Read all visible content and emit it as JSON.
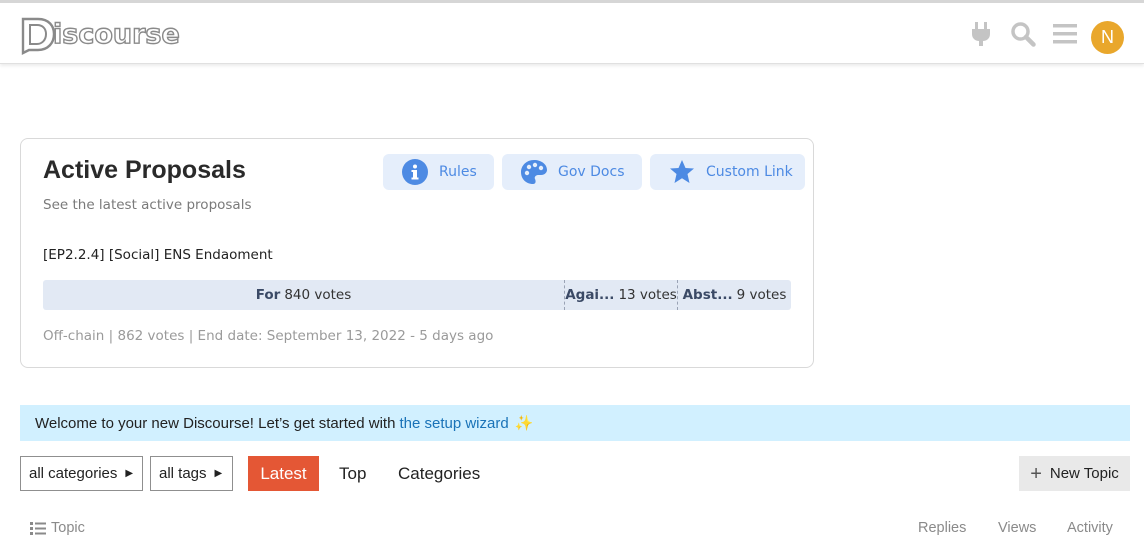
{
  "header": {
    "logo_text": "iscourse",
    "icons": [
      "plug-icon",
      "search-icon",
      "menu-icon"
    ],
    "avatar_letter": "N",
    "avatar_color": "#e9a72c"
  },
  "proposals": {
    "title": "Active Proposals",
    "subtitle": "See the latest active proposals",
    "links": [
      {
        "label": "Rules",
        "icon": "info-icon"
      },
      {
        "label": "Gov Docs",
        "icon": "palette-icon"
      },
      {
        "label": "Custom Link",
        "icon": "star-icon"
      }
    ],
    "proposal_title": "[EP2.2.4] [Social] ENS Endaoment",
    "votes": [
      {
        "choice": "For",
        "count": "840 votes",
        "value": 840
      },
      {
        "choice": "Agai...",
        "count": "13 votes",
        "value": 13
      },
      {
        "choice": "Abst...",
        "count": "9 votes",
        "value": 9
      }
    ],
    "meta": "Off-chain | 862 votes | End date: September 13, 2022 - 5 days ago"
  },
  "banner": {
    "text": "Welcome to your new Discourse! Let’s get started with",
    "link": "the setup wizard",
    "emoji": "✨"
  },
  "nav": {
    "categories_dropdown": "all categories",
    "tags_dropdown": "all tags",
    "tabs": [
      "Latest",
      "Top",
      "Categories"
    ],
    "new_topic": "New Topic"
  },
  "topic_list": {
    "columns": [
      "Topic",
      "Replies",
      "Views",
      "Activity"
    ]
  },
  "colors": {
    "accent": "#e45735",
    "link": "#4d8ae3",
    "banner_bg": "#d1f0ff"
  }
}
